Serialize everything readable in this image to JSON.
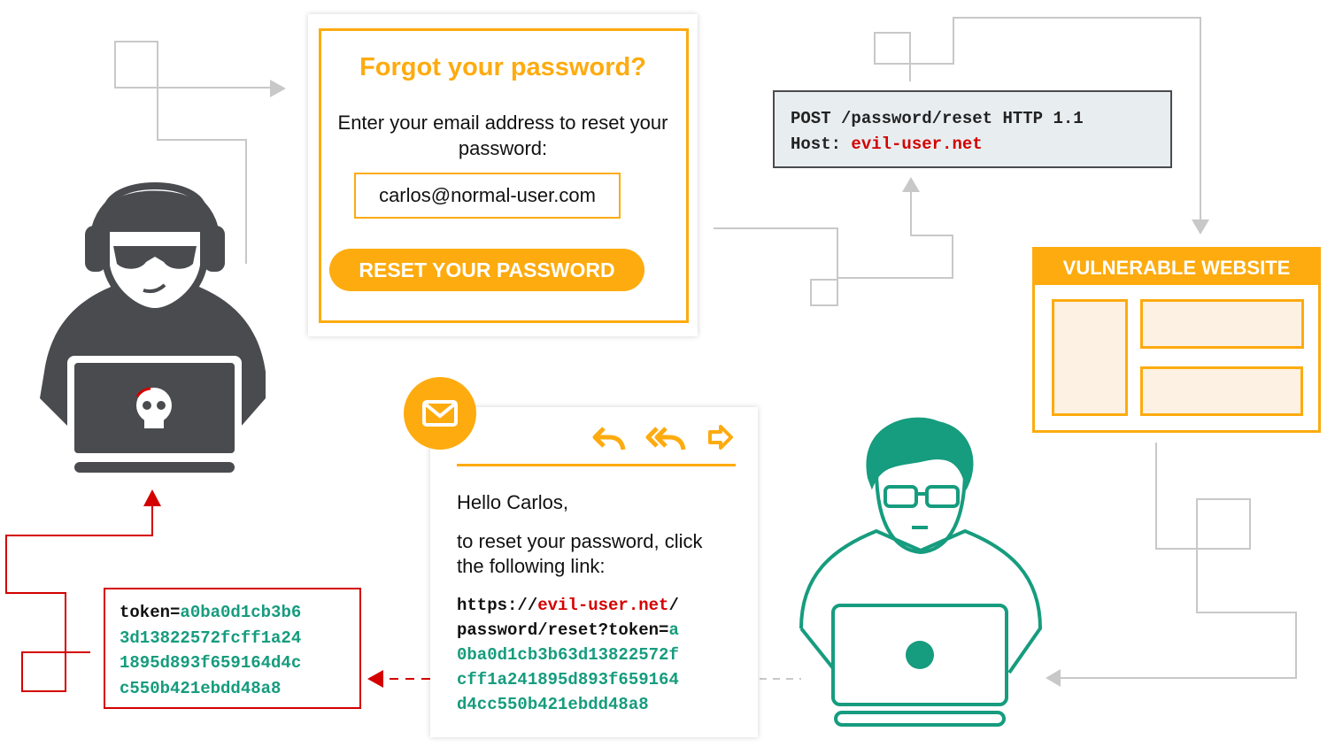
{
  "form": {
    "title": "Forgot your password?",
    "instructions": "Enter your email address to reset your password:",
    "email_value": "carlos@normal-user.com",
    "button_label": "RESET YOUR PASSWORD"
  },
  "request": {
    "line1": "POST /password/reset HTTP 1.1",
    "host_label": "Host: ",
    "host_value": "evil-user.net"
  },
  "website": {
    "title": "VULNERABLE WEBSITE"
  },
  "email": {
    "icons": [
      "envelope-icon",
      "reply-icon",
      "reply-all-icon",
      "forward-icon"
    ],
    "greeting": "Hello Carlos,",
    "body": "to reset your password, click the following link:",
    "link_scheme": "https://",
    "link_host": "evil-user.net",
    "link_path": "/\npassword/reset?token=",
    "link_token": "a\n0ba0d1cb3b63d13822572f\ncff1a241895d893f659164\nd4cc550b421ebdd48a8"
  },
  "stolen_token": {
    "label": "token=",
    "value": "a0ba0d1cb3b6\n3d13822572fcff1a24\n1895d893f659164d4c\nc550b421ebdd48a8"
  },
  "colors": {
    "accent": "#fdab0f",
    "attacker": "#4a4b4f",
    "victim": "#169c7e",
    "danger": "#d40000",
    "connector": "#c8c8c8"
  }
}
